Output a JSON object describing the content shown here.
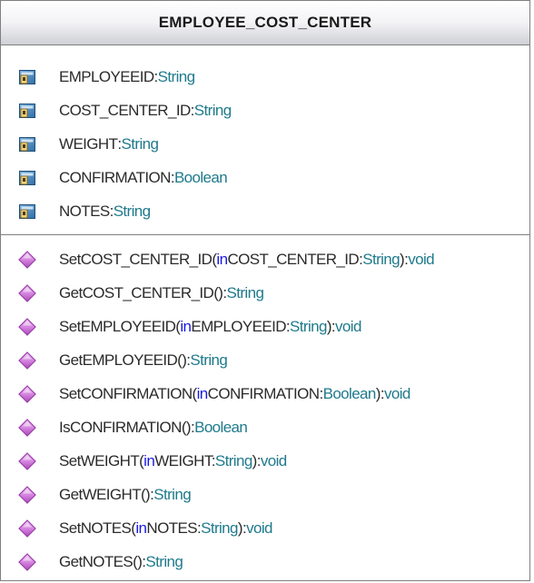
{
  "class_name": "EMPLOYEE_COST_CENTER",
  "icons": {
    "attribute": "attribute-field-icon",
    "operation": "operation-diamond-icon"
  },
  "colors": {
    "keyword": "#1a1ae6",
    "type": "#1f7a8c",
    "text": "#2b2b2b",
    "operation_icon": "#c86fd6"
  },
  "attributes": [
    {
      "name": "EMPLOYEEID",
      "sep": ":",
      "type": "String"
    },
    {
      "name": "COST_CENTER_ID",
      "sep": ":",
      "type": "String"
    },
    {
      "name": "WEIGHT",
      "sep": ":",
      "type": "String"
    },
    {
      "name": "CONFIRMATION",
      "sep": ":",
      "type": "Boolean"
    },
    {
      "name": "NOTES",
      "sep": ":",
      "type": "String"
    }
  ],
  "operations": [
    {
      "name": "SetCOST_CENTER_ID(",
      "kw": "in",
      "param": " COST_CENTER_ID:",
      "ptype": "String",
      "close": "):",
      "ret": "void"
    },
    {
      "name": "GetCOST_CENTER_ID():",
      "kw": "",
      "param": "",
      "ptype": "",
      "close": "",
      "ret": "String"
    },
    {
      "name": "SetEMPLOYEEID(",
      "kw": "in",
      "param": " EMPLOYEEID:",
      "ptype": "String",
      "close": "):",
      "ret": "void"
    },
    {
      "name": "GetEMPLOYEEID():",
      "kw": "",
      "param": "",
      "ptype": "",
      "close": "",
      "ret": "String"
    },
    {
      "name": "SetCONFIRMATION(",
      "kw": "in",
      "param": " CONFIRMATION:",
      "ptype": "Boolean",
      "close": "):",
      "ret": "void"
    },
    {
      "name": "IsCONFIRMATION():",
      "kw": "",
      "param": "",
      "ptype": "",
      "close": "",
      "ret": "Boolean"
    },
    {
      "name": "SetWEIGHT(",
      "kw": "in",
      "param": " WEIGHT:",
      "ptype": "String",
      "close": "):",
      "ret": "void"
    },
    {
      "name": "GetWEIGHT():",
      "kw": "",
      "param": "",
      "ptype": "",
      "close": "",
      "ret": "String"
    },
    {
      "name": "SetNOTES(",
      "kw": "in",
      "param": " NOTES:",
      "ptype": "String",
      "close": "):",
      "ret": "void"
    },
    {
      "name": "GetNOTES():",
      "kw": "",
      "param": "",
      "ptype": "",
      "close": "",
      "ret": "String"
    }
  ]
}
